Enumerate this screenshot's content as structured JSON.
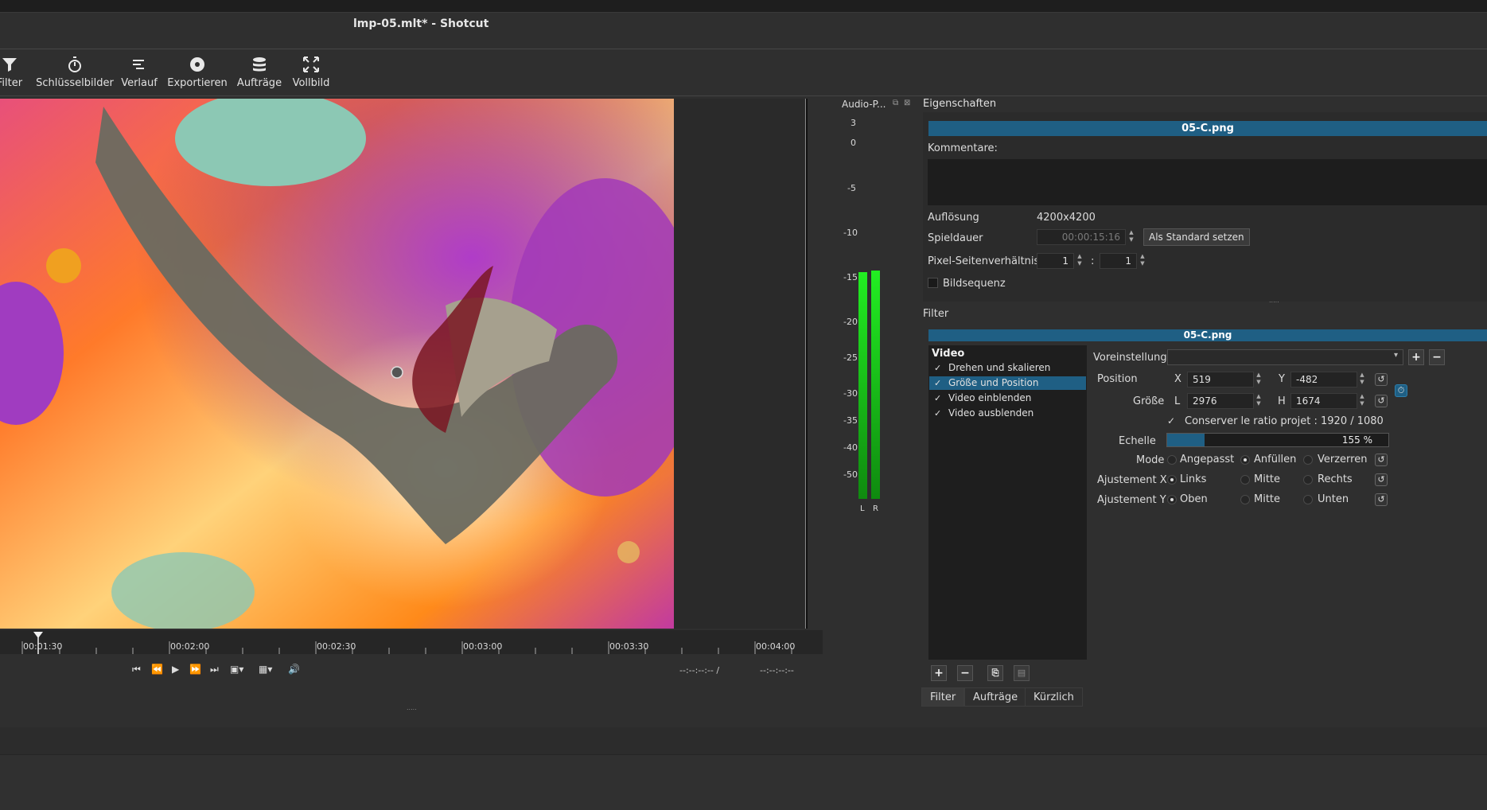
{
  "window": {
    "title": "lmp-05.mlt* - Shotcut"
  },
  "toolbar": {
    "items": [
      {
        "label": "Filter",
        "icon": "filter-icon"
      },
      {
        "label": "Schlüsselbilder",
        "icon": "stopwatch-icon"
      },
      {
        "label": "Verlauf",
        "icon": "history-icon"
      },
      {
        "label": "Exportieren",
        "icon": "export-disc-icon"
      },
      {
        "label": "Aufträge",
        "icon": "jobs-stack-icon"
      },
      {
        "label": "Vollbild",
        "icon": "fullscreen-icon"
      }
    ]
  },
  "timeline": {
    "ticks": [
      "00:01:30",
      "00:02:00",
      "00:02:30",
      "00:03:00",
      "00:03:30",
      "00:04:00"
    ],
    "timecode_current": "--:--:--:-- /",
    "timecode_total": "--:--:--:--"
  },
  "audio": {
    "title": "Audio-P...",
    "scale": [
      "3",
      "0",
      "-5",
      "-10",
      "-15",
      "-20",
      "-25",
      "-30",
      "-35",
      "-40",
      "-50"
    ],
    "channels": [
      "L",
      "R"
    ]
  },
  "properties": {
    "title": "Eigenschaften",
    "clip_name": "05-C.png",
    "comments_label": "Kommentare:",
    "resolution_label": "Auflösung",
    "resolution_value": "4200x4200",
    "duration_label": "Spieldauer",
    "duration_value": "00:00:15:16",
    "set_default_button": "Als Standard setzen",
    "aspect_label": "Pixel-Seitenverhältnis",
    "aspect_num": "1",
    "aspect_sep": ":",
    "aspect_den": "1",
    "image_sequence_label": "Bildsequenz"
  },
  "filter": {
    "title": "Filter",
    "clip_name": "05-C.png",
    "list_header": "Video",
    "items": [
      {
        "label": "Drehen und skalieren",
        "checked": true,
        "selected": false
      },
      {
        "label": "Größe und Position",
        "checked": true,
        "selected": true
      },
      {
        "label": "Video einblenden",
        "checked": true,
        "selected": false
      },
      {
        "label": "Video ausblenden",
        "checked": true,
        "selected": false
      }
    ],
    "preset_label": "Voreinstellung",
    "position_label": "Position",
    "x_label": "X",
    "x_value": "519",
    "y_label": "Y",
    "y_value": "-482",
    "size_label": "Größe",
    "w_label": "L",
    "w_value": "2976",
    "h_label": "H",
    "h_value": "1674",
    "ratio_label": "Conserver le ratio projet : 1920 / 1080",
    "echelle_label": "Echelle",
    "echelle_value": "155 %",
    "echelle_fraction": 0.17,
    "mode_label": "Mode",
    "mode_options": [
      "Angepasst",
      "Anfüllen",
      "Verzerren"
    ],
    "mode_selected": "Anfüllen",
    "ajx_label": "Ajustement X",
    "ajx_options": [
      "Links",
      "Mitte",
      "Rechts"
    ],
    "ajx_selected": "Links",
    "ajy_label": "Ajustement Y",
    "ajy_options": [
      "Oben",
      "Mitte",
      "Unten"
    ],
    "ajy_selected": "Oben"
  },
  "bottom_tabs": [
    "Filter",
    "Aufträge",
    "Kürzlich"
  ],
  "colors": {
    "accent": "#1f5f84",
    "meter_green": "#22ee22"
  }
}
